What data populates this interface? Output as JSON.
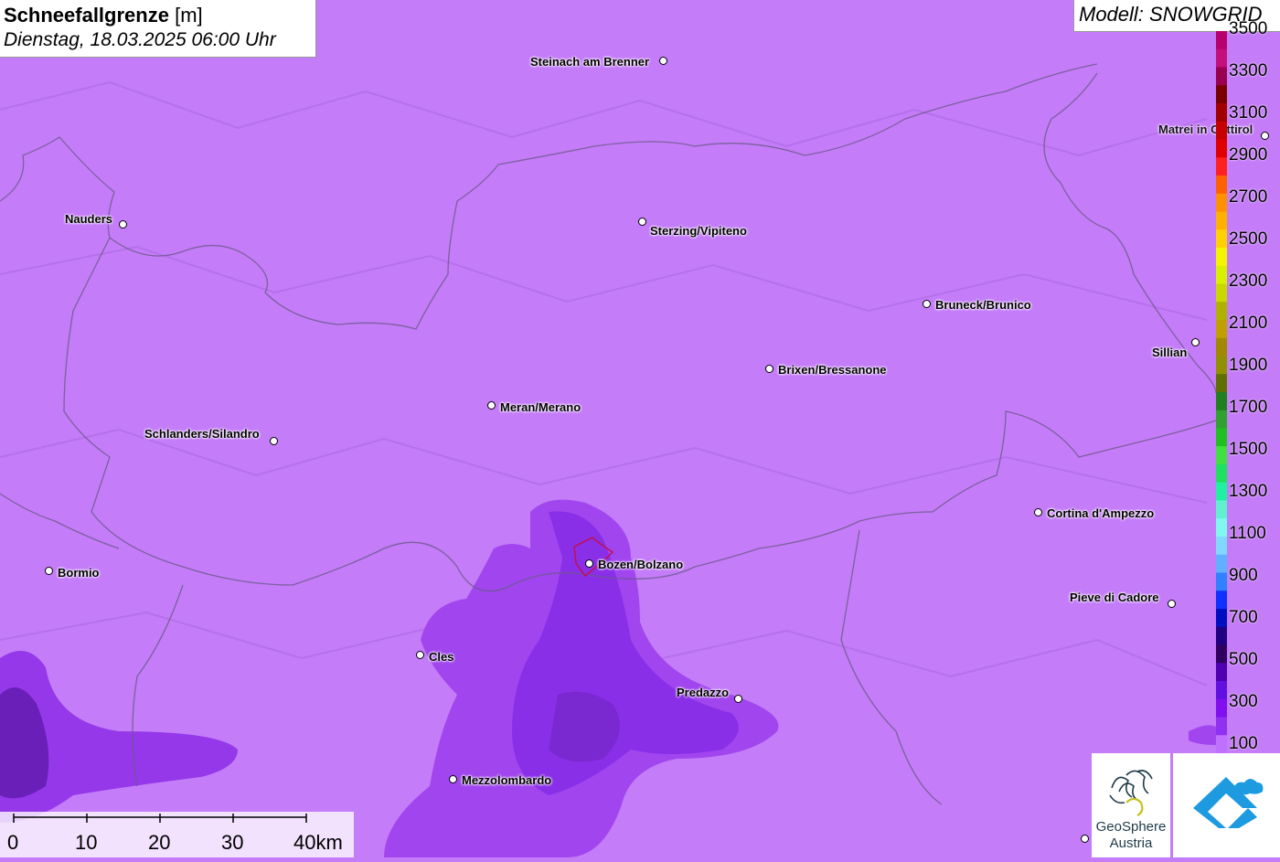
{
  "title": {
    "name": "Schneefallgrenze",
    "unit": "[m]",
    "datetime": "Dienstag, 18.03.2025 06:00 Uhr"
  },
  "model": "Modell: SNOWGRID",
  "towns": [
    {
      "name": "Steinach am Brenner"
    },
    {
      "name": "Nauders"
    },
    {
      "name": "Sterzing/Vipiteno"
    },
    {
      "name": "Matrei in Osttirol"
    },
    {
      "name": "Bruneck/Brunico"
    },
    {
      "name": "Sillian"
    },
    {
      "name": "Brixen/Bressanone"
    },
    {
      "name": "Meran/Merano"
    },
    {
      "name": "Schlanders/Silandro"
    },
    {
      "name": "Cortina d'Ampezzo"
    },
    {
      "name": "Bormio"
    },
    {
      "name": "Bozen/Bolzano"
    },
    {
      "name": "Pieve di Cadore"
    },
    {
      "name": "Cles"
    },
    {
      "name": "Predazzo"
    },
    {
      "name": "Mezzolombardo"
    }
  ],
  "legend": {
    "labels": [
      "3500",
      "3300",
      "3100",
      "2900",
      "2700",
      "2500",
      "2300",
      "2100",
      "1900",
      "1700",
      "1500",
      "1300",
      "1100",
      "900",
      "700",
      "500",
      "300",
      "100"
    ],
    "colors": [
      "#b8006e",
      "#c4107a",
      "#9a0050",
      "#7a0000",
      "#a00000",
      "#c80000",
      "#e00000",
      "#ff2020",
      "#ff6000",
      "#ff9000",
      "#ffb000",
      "#ffd000",
      "#f4f400",
      "#d8f000",
      "#c8d800",
      "#b0b000",
      "#c0a000",
      "#a08800",
      "#909000",
      "#607000",
      "#208020",
      "#30a030",
      "#20c020",
      "#40e040",
      "#20e060",
      "#20f0a0",
      "#60f0d0",
      "#80f8f0",
      "#80d8ff",
      "#60b0ff",
      "#3080ff",
      "#1030ff",
      "#0010c0",
      "#200080",
      "#300060",
      "#5000b0",
      "#6010e0",
      "#8010f0",
      "#9030f0",
      "#c070ff"
    ]
  },
  "scale": {
    "labels": [
      "0",
      "10",
      "20",
      "30",
      "40km"
    ]
  },
  "logos": {
    "geosphere_line1": "GeoSphere",
    "geosphere_line2": "Austria"
  }
}
